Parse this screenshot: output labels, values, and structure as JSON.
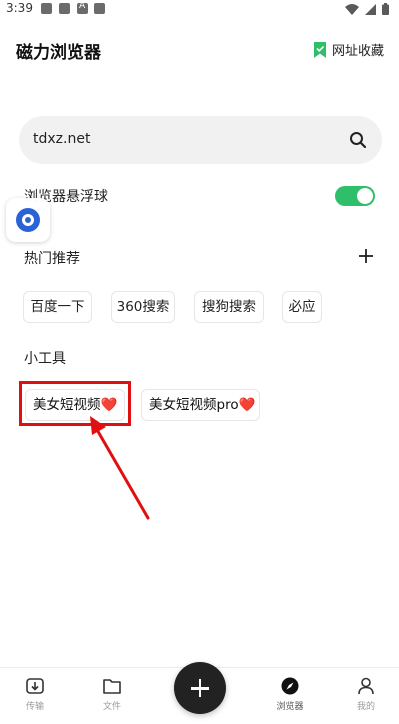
{
  "status_bar": {
    "time": "3:39",
    "icons": [
      "app-icon",
      "app-icon",
      "a-app-icon",
      "app-icon",
      "wifi-icon",
      "signal-icon",
      "battery-icon"
    ]
  },
  "header": {
    "title": "磁力浏览器",
    "bookmark_label": "网址收藏",
    "bookmark_icon": "bookmark-icon",
    "accent_color": "#2fbf6b"
  },
  "search": {
    "value": "tdxz.net",
    "icon": "search-icon"
  },
  "floating_ball": {
    "label": "浏览器悬浮球",
    "enabled": true
  },
  "hot_recommend": {
    "label": "热门推荐",
    "items": [
      "百度一下",
      "360搜索",
      "搜狗搜索",
      "必应"
    ]
  },
  "tools": {
    "label": "小工具",
    "items": [
      {
        "label": "美女短视频",
        "emoji": "❤️"
      },
      {
        "label": "美女短视频pro",
        "emoji": "❤️"
      }
    ]
  },
  "annotation": {
    "color": "#e01010"
  },
  "bottom_nav": {
    "items": [
      {
        "label": "传输",
        "icon": "transfer-icon"
      },
      {
        "label": "文件",
        "icon": "folder-icon"
      },
      {
        "label": "浏览器",
        "icon": "compass-icon"
      },
      {
        "label": "我的",
        "icon": "user-icon"
      }
    ],
    "fab_icon": "plus-icon"
  }
}
